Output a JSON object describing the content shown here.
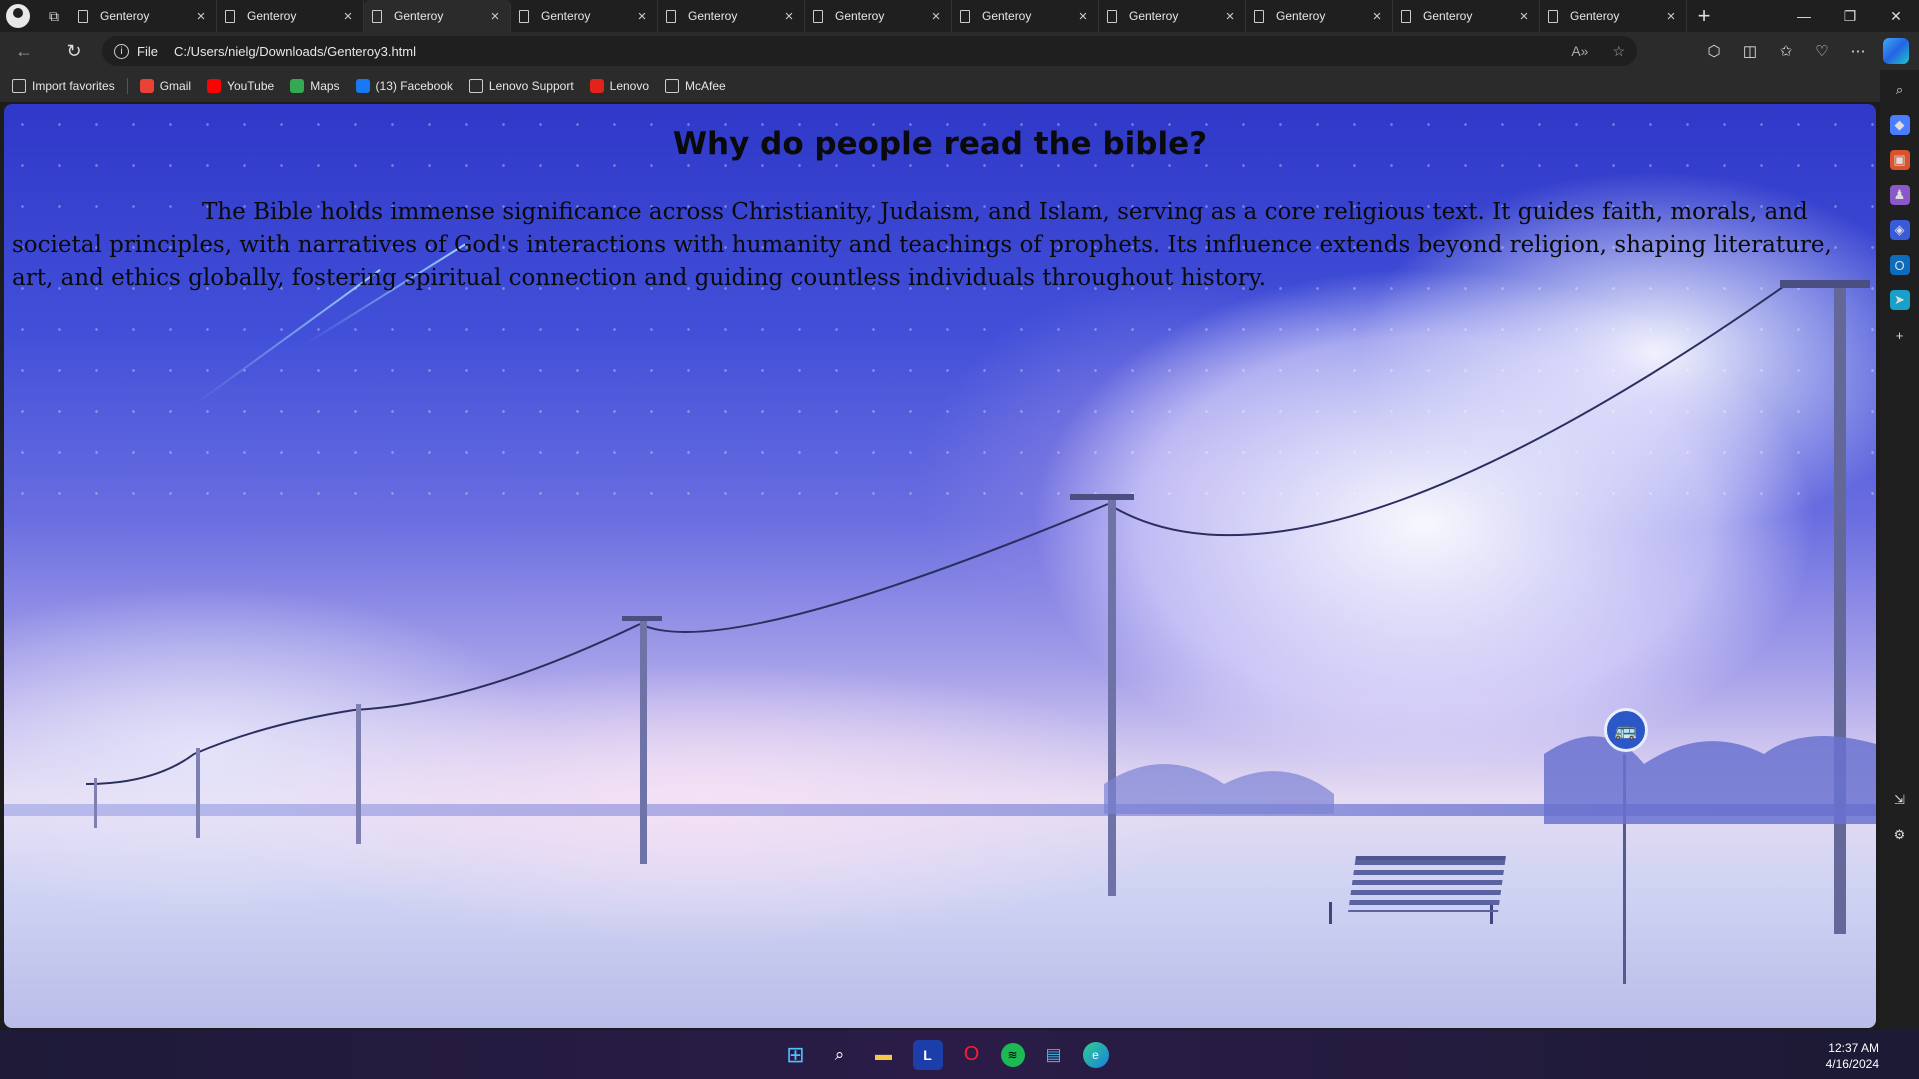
{
  "browser": {
    "tabs": [
      {
        "title": "Genteroy"
      },
      {
        "title": "Genteroy"
      },
      {
        "title": "Genteroy",
        "active": true
      },
      {
        "title": "Genteroy"
      },
      {
        "title": "Genteroy"
      },
      {
        "title": "Genteroy"
      },
      {
        "title": "Genteroy"
      },
      {
        "title": "Genteroy"
      },
      {
        "title": "Genteroy"
      },
      {
        "title": "Genteroy"
      },
      {
        "title": "Genteroy"
      }
    ],
    "address": {
      "scheme_label": "File",
      "url": "C:/Users/nielg/Downloads/Genteroy3.html"
    },
    "bookmarks": [
      {
        "label": "Import favorites",
        "icon": "import-icon"
      },
      {
        "label": "Gmail",
        "icon": "gmail-icon",
        "color": "#ea4335"
      },
      {
        "label": "YouTube",
        "icon": "youtube-icon",
        "color": "#ff0000"
      },
      {
        "label": "Maps",
        "icon": "maps-icon",
        "color": "#34a853"
      },
      {
        "label": "(13) Facebook",
        "icon": "facebook-icon",
        "color": "#1877f2"
      },
      {
        "label": "Lenovo Support",
        "icon": "page-icon"
      },
      {
        "label": "Lenovo",
        "icon": "lenovo-icon",
        "color": "#e2231a"
      },
      {
        "label": "McAfee",
        "icon": "page-icon"
      }
    ]
  },
  "page": {
    "title": "Why do people read the bible?",
    "body": "The Bible holds immense significance across Christianity, Judaism, and Islam, serving as a core religious text. It guides faith, morals, and societal principles, with narratives of God's interactions with humanity and teachings of prophets. Its influence extends beyond religion, shaping literature, art, and ethics globally, fostering spiritual connection and guiding countless individuals throughout history."
  },
  "taskbar": {
    "apps": [
      "windows-start-icon",
      "search-icon",
      "file-explorer-icon",
      "lenovo-app-icon",
      "opera-icon",
      "spotify-icon",
      "notepad-icon",
      "edge-icon"
    ],
    "time": "12:37 AM",
    "date": "4/16/2024"
  }
}
